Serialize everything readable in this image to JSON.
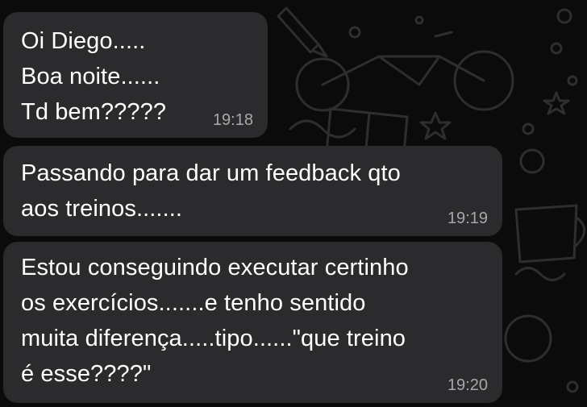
{
  "conversation": {
    "messages": [
      {
        "text": "Oi Diego.....\nBoa noite......\nTd bem?????",
        "time": "19:18"
      },
      {
        "text": "Passando para dar um feedback qto\naos treinos.......",
        "time": "19:19"
      },
      {
        "text": "Estou conseguindo executar certinho\nos exercícios.......e tenho sentido\nmuita diferença.....tipo......\"que treino\né esse????\"",
        "time": "19:20"
      }
    ]
  },
  "colors": {
    "background": "#0b0b0b",
    "bubble": "#2b2b2d",
    "text": "#ffffff",
    "timestamp": "#a8a8aa",
    "doodle": "#2e2e2e"
  }
}
